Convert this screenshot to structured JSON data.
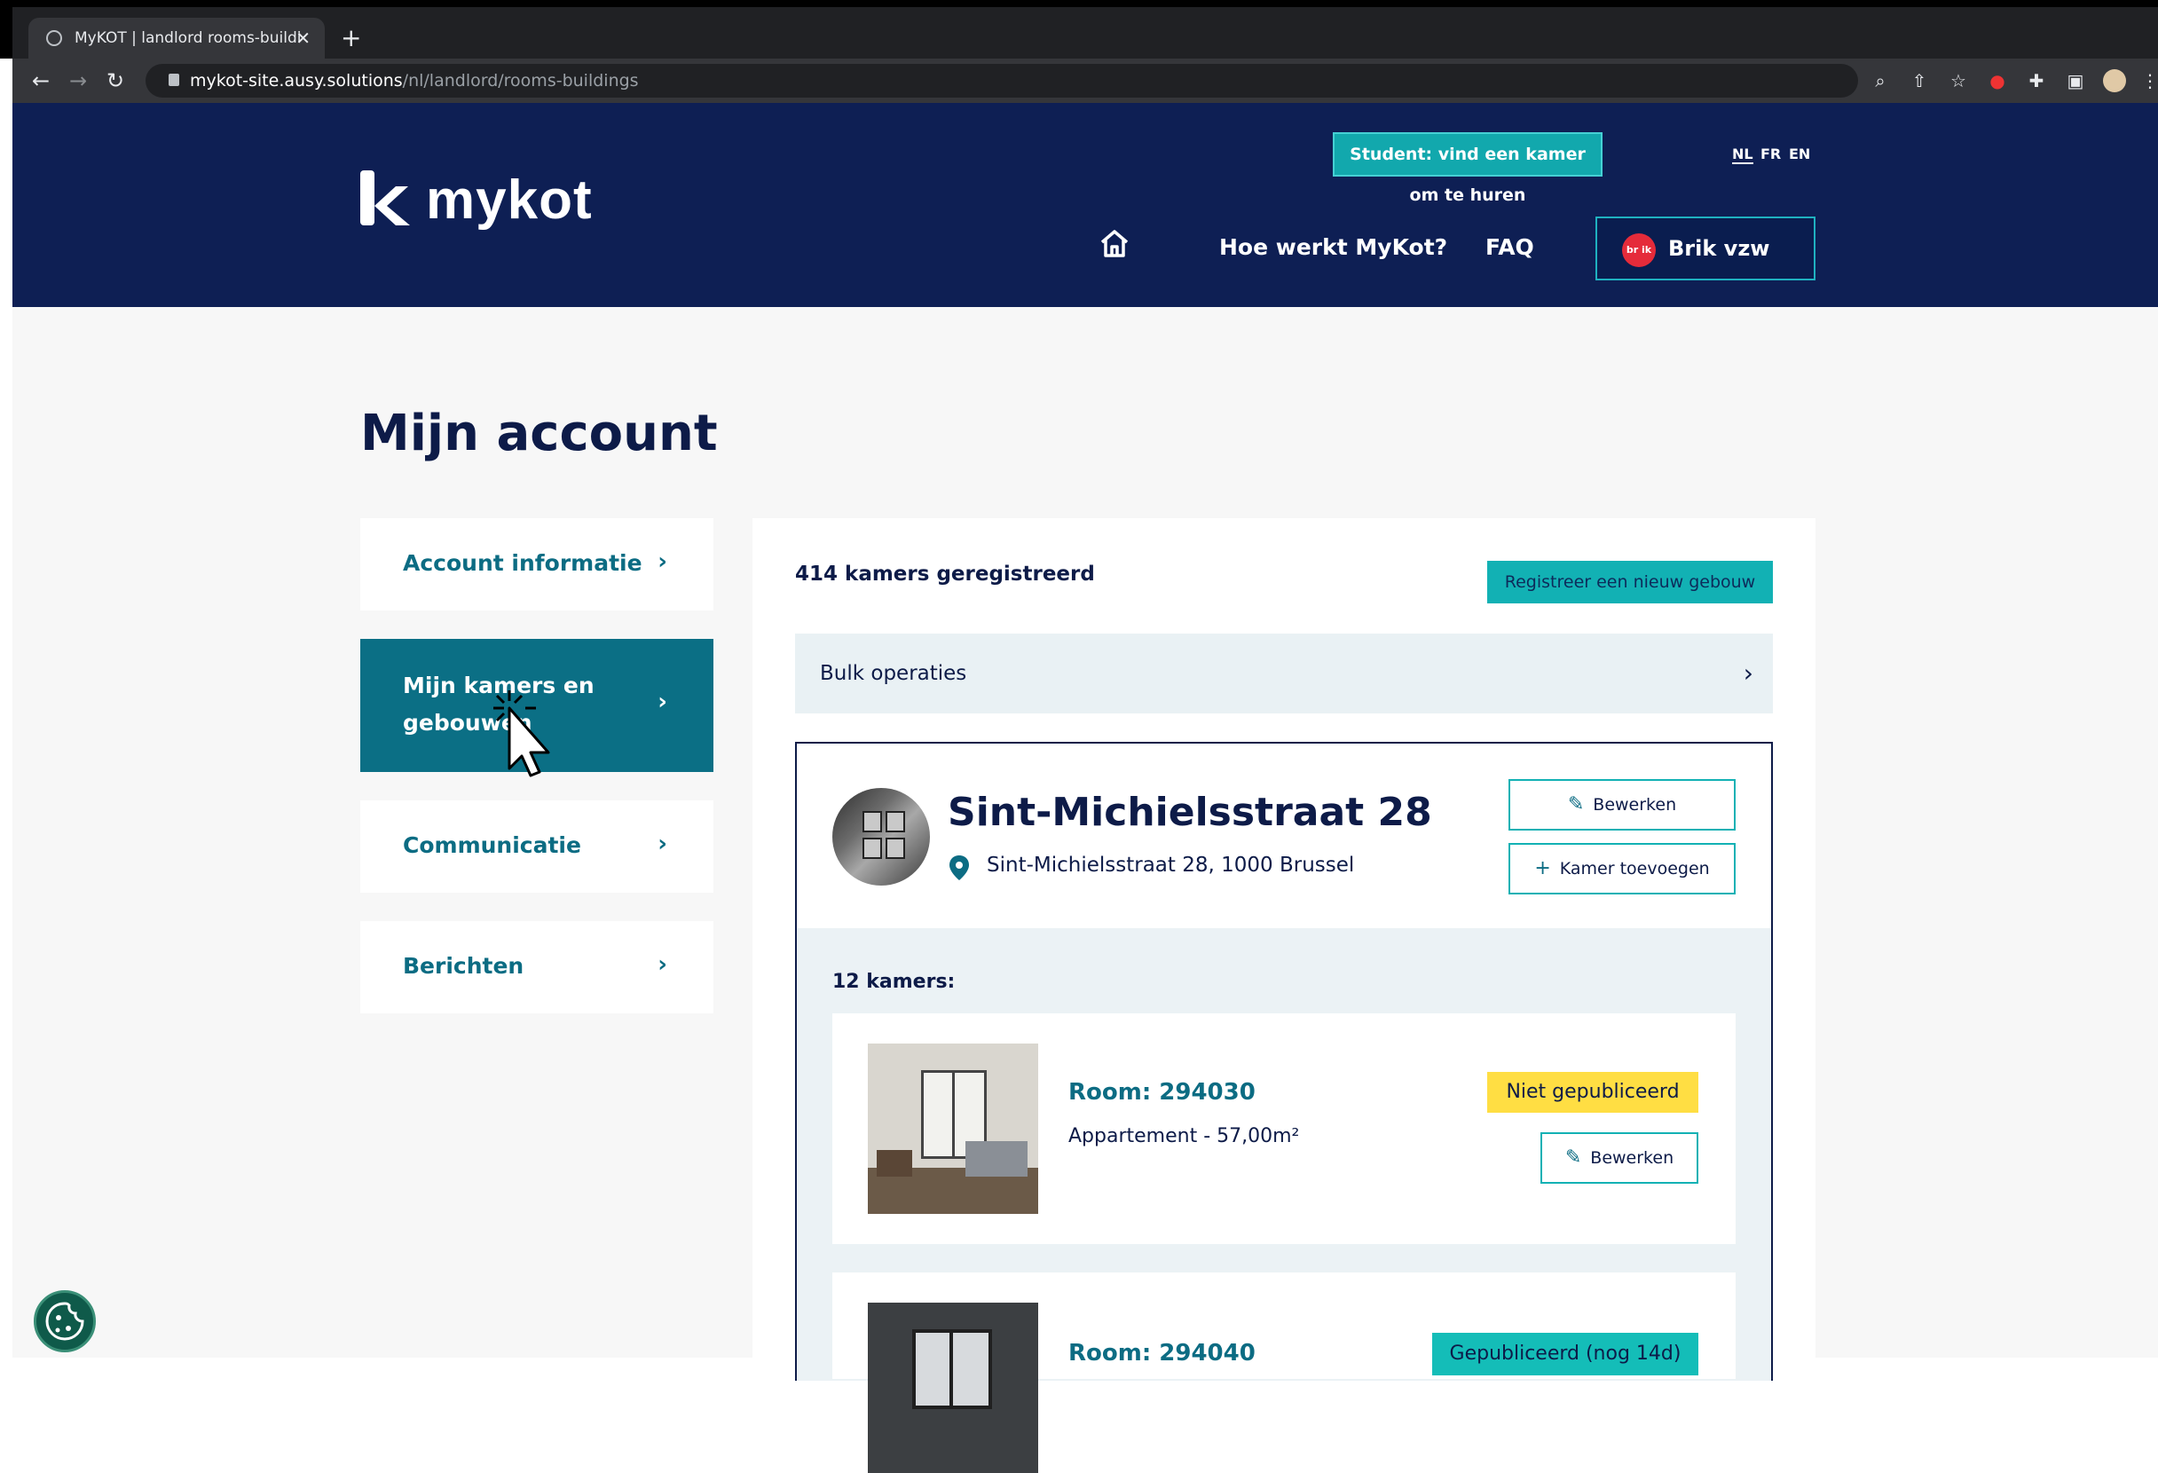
{
  "browser": {
    "tab_title": "MyKOT | landlord rooms-buildi",
    "url_host": "mykot-site.ausy.solutions",
    "url_path": "/nl/landlord/rooms-buildings"
  },
  "header": {
    "logo_text": "mykot",
    "student_button": "Student: vind een kamer om te huren",
    "languages": [
      "NL",
      "FR",
      "EN"
    ],
    "active_language": "NL",
    "nav": {
      "how": "Hoe werkt MyKot?",
      "faq": "FAQ"
    },
    "user": {
      "name": "Brik vzw",
      "avatar_text": "br ik"
    }
  },
  "page": {
    "title": "Mijn account",
    "menu": [
      {
        "label": "Account informatie"
      },
      {
        "label": "Mijn kamers en gebouwen"
      },
      {
        "label": "Communicatie"
      },
      {
        "label": "Berichten"
      }
    ]
  },
  "panel": {
    "count_text": "414 kamers geregistreerd",
    "register_button": "Registreer een nieuw gebouw",
    "bulk_label": "Bulk operaties",
    "building": {
      "name": "Sint-Michielsstraat 28",
      "address": "Sint-Michielsstraat 28, 1000 Brussel",
      "edit_button": "Bewerken",
      "add_room_button": "Kamer toevoegen",
      "rooms_heading": "12 kamers:",
      "rooms": [
        {
          "title": "Room: 294030",
          "subtitle": "Appartement - 57,00m²",
          "status": "Niet gepubliceerd",
          "edit": "Bewerken"
        },
        {
          "title": "Room: 294040",
          "status": "Gepubliceerd (nog 14d)"
        }
      ]
    }
  },
  "colors": {
    "navy": "#0e1f54",
    "teal": "#12b1b4",
    "active_menu": "#0b6f85",
    "unpublished": "#ffde43",
    "published": "#14bdb8"
  }
}
